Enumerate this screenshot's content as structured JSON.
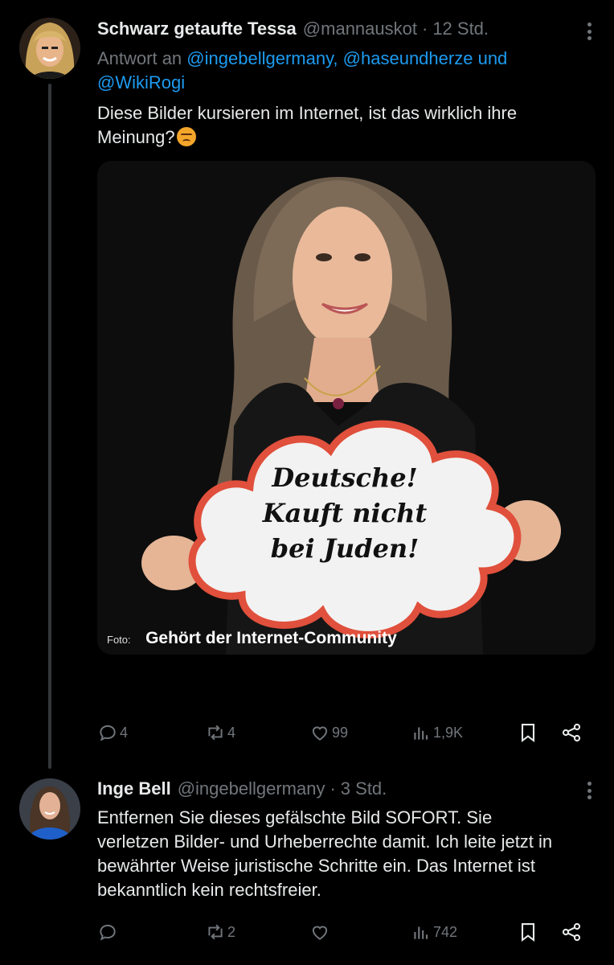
{
  "tweets": [
    {
      "author": {
        "name": "Schwarz getaufte Tessa",
        "handle": "@mannauskot",
        "time": "12 Std."
      },
      "reply": {
        "prefix": "Antwort an",
        "first": "@ingebellgermany,",
        "second": "@haseundherze",
        "and": "und",
        "third": "@WikiRogi"
      },
      "text_line1": "Diese Bilder kursieren im Internet, ist das wirklich ihre",
      "text_line2": "Meinung?",
      "emoji": "angry-face-emoji",
      "image": {
        "sign_line1": "Deutsche!",
        "sign_line2": "Kauft nicht",
        "sign_line3": "bei Juden!",
        "credit_prefix": "Foto:",
        "credit_text": "Gehört der Internet-Community"
      },
      "stats": {
        "replies": "4",
        "reposts": "4",
        "likes": "99",
        "views": "1,9K"
      }
    },
    {
      "author": {
        "name": "Inge Bell",
        "handle": "@ingebellgermany",
        "time": "3 Std."
      },
      "text_line1": "Entfernen Sie dieses gefälschte Bild SOFORT. Sie",
      "text_line2": "verletzen Bilder- und Urheberrechte damit. Ich leite jetzt in",
      "text_line3": "bewährter Weise juristische Schritte ein. Das Internet ist",
      "text_line4": "bekanntlich kein rechtsfreier.",
      "stats": {
        "replies": "",
        "reposts": "2",
        "likes": "",
        "views": "742"
      }
    }
  ],
  "colors": {
    "background": "#000000",
    "text": "#e7e9ea",
    "muted": "#71767b",
    "link": "#1d9bf0",
    "thread_line": "#333639"
  }
}
